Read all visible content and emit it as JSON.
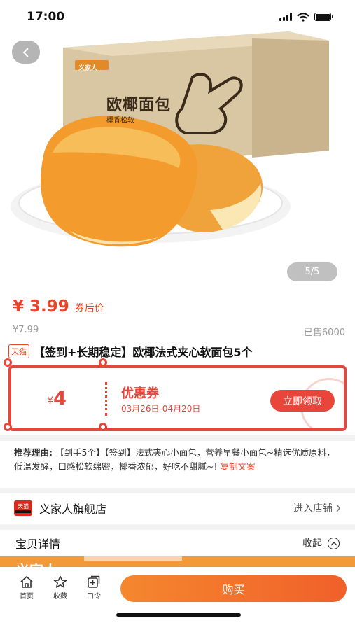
{
  "status_bar": {
    "time": "17:00"
  },
  "hero": {
    "box_brand": "义家人",
    "box_title": "欧椰面包",
    "box_subtitle": "椰香松软",
    "page_indicator": "5/5"
  },
  "price": {
    "current": "¥ 3.99",
    "current_label": "券后价",
    "original": "¥7.99",
    "sold": "已售6000"
  },
  "product": {
    "badge": "天猫",
    "title": "【签到+长期稳定】欧椰法式夹心软面包5个"
  },
  "coupon": {
    "currency": "¥",
    "amount": "4",
    "name": "优惠券",
    "dates": "03月26日-04月20日",
    "button": "立即领取"
  },
  "reason": {
    "label": "推荐理由:",
    "text": "【到手5个】【签到】法式夹心小面包，营养早餐小面包~精选优质原料，低温发酵，口感松软绵密，椰香浓郁，好吃不甜腻~!",
    "copy_link": "复制文案"
  },
  "store": {
    "logo_text": "天猫",
    "name": "义家人旗舰店",
    "enter": "进入店铺"
  },
  "details": {
    "title": "宝贝详情",
    "collapse": "收起",
    "image_text": "义家人"
  },
  "bottom_bar": {
    "tabs": [
      {
        "label": "首页",
        "icon": "home-icon"
      },
      {
        "label": "收藏",
        "icon": "star-icon"
      },
      {
        "label": "口令",
        "icon": "command-icon"
      }
    ],
    "buy": "购买"
  },
  "colors": {
    "accent": "#e8462b",
    "coupon": "#e8463a",
    "buy_gradient_start": "#f5872e",
    "buy_gradient_end": "#f0602a"
  }
}
